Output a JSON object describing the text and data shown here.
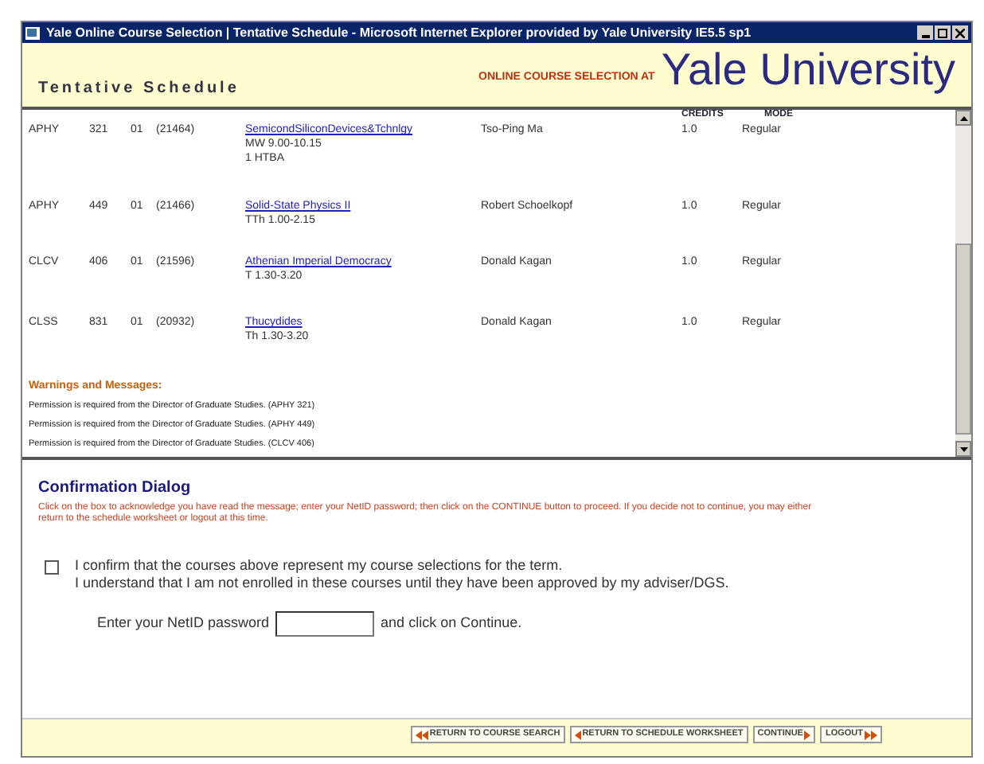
{
  "window": {
    "title": "Yale Online Course Selection | Tentative Schedule - Microsoft Internet Explorer provided by Yale University IE5.5 sp1"
  },
  "header": {
    "page_title": "Tentative Schedule",
    "tagline": "ONLINE COURSE SELECTION AT",
    "brand": "Yale University"
  },
  "schedule": {
    "columns": [
      "CREDITS",
      "MODE"
    ],
    "rows": [
      {
        "subject": "APHY",
        "number": "321",
        "section": "01",
        "crn": "(21464)",
        "title": "SemicondSiliconDevices&Tchnlgy",
        "details": [
          "MW 9.00-10.15",
          "1 HTBA"
        ],
        "instructor": "Tso-Ping Ma",
        "credits": "1.0",
        "mode": "Regular"
      },
      {
        "subject": "APHY",
        "number": "449",
        "section": "01",
        "crn": "(21466)",
        "title": "Solid-State Physics II",
        "details": [
          "TTh 1.00-2.15"
        ],
        "instructor": "Robert Schoelkopf",
        "credits": "1.0",
        "mode": "Regular"
      },
      {
        "subject": "CLCV",
        "number": "406",
        "section": "01",
        "crn": "(21596)",
        "title": "Athenian Imperial Democracy",
        "details": [
          "T 1.30-3.20"
        ],
        "instructor": "Donald Kagan",
        "credits": "1.0",
        "mode": "Regular"
      },
      {
        "subject": "CLSS",
        "number": "831",
        "section": "01",
        "crn": "(20932)",
        "title": "Thucydides",
        "details": [
          "Th 1.30-3.20"
        ],
        "instructor": "Donald Kagan",
        "credits": "1.0",
        "mode": "Regular"
      }
    ],
    "warnings_heading": "Warnings and Messages:",
    "warnings": [
      "Permission is required from the Director of Graduate Studies. (APHY 321)",
      "Permission is required from the Director of Graduate Studies. (APHY 449)",
      "Permission is required from the Director of Graduate Studies. (CLCV 406)"
    ]
  },
  "confirmation": {
    "heading": "Confirmation Dialog",
    "instructions": "Click on the box to acknowledge you have read the message; enter your NetID password; then click on the CONTINUE button to proceed. If you decide not to continue, you may either return to the schedule worksheet or logout at this time.",
    "checkbox": {
      "checked": false,
      "lines": [
        "I confirm that the courses above represent my course selections for the term.",
        "I understand that I am not enrolled in these courses until they have been approved by my adviser/DGS."
      ]
    },
    "password_label": "Enter your NetID password",
    "password_suffix": "and click on Continue."
  },
  "buttons": [
    {
      "label": "RETURN TO COURSE SEARCH",
      "kind": "back2"
    },
    {
      "label": "RETURN TO SCHEDULE WORKSHEET",
      "kind": "back"
    },
    {
      "label": "CONTINUE",
      "kind": "next"
    },
    {
      "label": "LOGOUT",
      "kind": "next2"
    }
  ]
}
